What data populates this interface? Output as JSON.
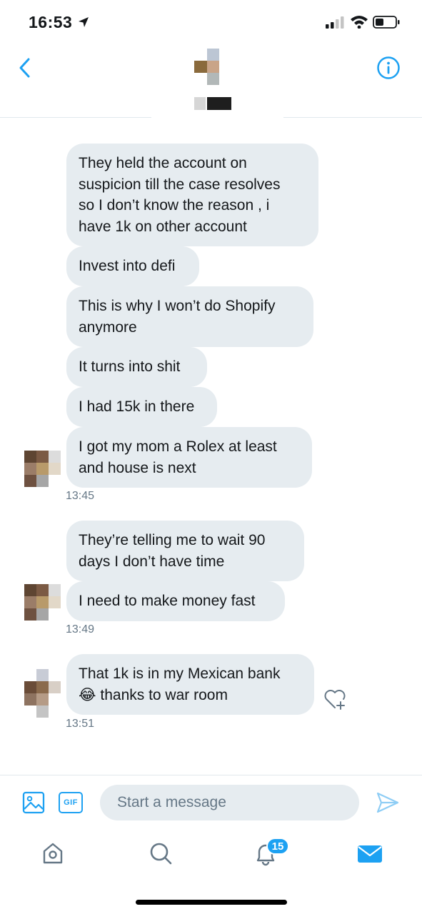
{
  "status_bar": {
    "time": "16:53"
  },
  "header": {
    "back_icon": "chevron-left-icon",
    "info_icon": "info-circle-icon",
    "contact_avatar_colors": [
      "#bcc6d4",
      "#8a6a3c",
      "#c9a488",
      "#b2b8b8"
    ],
    "contact_name_colors": [
      "#d6d6d6",
      "#1e1e1e"
    ]
  },
  "messages": [
    {
      "text": "They held the account on\nsuspicion till the case resolves\nso I don’t know the reason , i\nhave 1k on other account"
    },
    {
      "text": "Invest into defi"
    },
    {
      "text": "This is why I won’t do Shopify\nanymore"
    },
    {
      "text": "It turns into shit"
    },
    {
      "text": "I had 15k in there"
    },
    {
      "text": "I got my mom a Rolex at least\nand house is next"
    },
    {
      "text": "They’re telling me to wait 90\ndays I don’t have time"
    },
    {
      "text": "I need to make money fast"
    },
    {
      "text": "That 1k is in my Mexican bank\n😂 thanks to war room"
    }
  ],
  "timestamps": [
    "13:45",
    "13:49",
    "13:51"
  ],
  "composer": {
    "gif_label": "GIF",
    "placeholder": "Start a message"
  },
  "tabbar": {
    "notifications_badge": "15"
  },
  "colors": {
    "accent": "#1da1f2",
    "bubble_bg": "#e6ecf0",
    "timestamp": "#657786",
    "divider": "#e1e8ed"
  }
}
